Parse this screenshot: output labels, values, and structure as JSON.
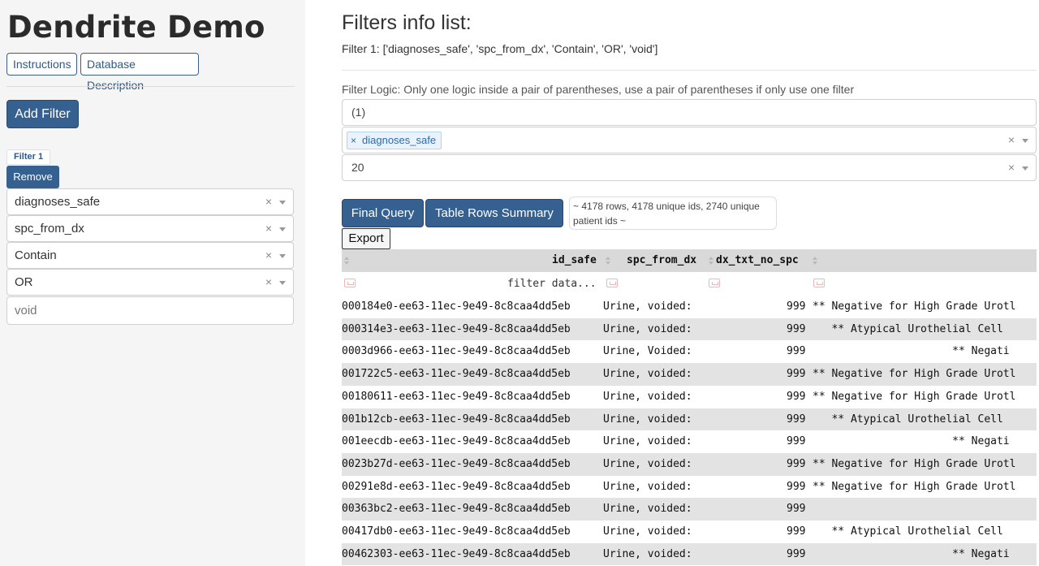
{
  "sidebar": {
    "title": "Dendrite Demo",
    "instructions_label": "Instructions",
    "db_description_label": "Database Description",
    "add_filter_label": "Add Filter",
    "filter_tag": "Filter 1",
    "remove_label": "Remove",
    "fields": [
      "diagnoses_safe",
      "spc_from_dx",
      "Contain",
      "OR"
    ],
    "text_value": "void"
  },
  "main": {
    "title": "Filters info list:",
    "filter_line": "Filter 1: ['diagnoses_safe', 'spc_from_dx', 'Contain', 'OR', 'void']",
    "logic_label": "Filter Logic: Only one logic inside a pair of parentheses, use a pair of parentheses if only use one filter",
    "logic_value": "(1)",
    "selected_chip": "diagnoses_safe",
    "limit_value": "20",
    "final_query_label": "Final Query",
    "table_summary_label": "Table Rows Summary",
    "summary_text": "~ 4178 rows, 4178 unique ids, 2740 unique patient ids ~",
    "export_label": "Export"
  },
  "table": {
    "headers": [
      "id_safe",
      "spc_from_dx",
      "dx_txt_no_spc"
    ],
    "filter_placeholder": "filter data...",
    "rows": [
      [
        "000184e0-ee63-11ec-9e49-8c8caa4dd5eb",
        "Urine, voided:",
        "999",
        "** Negative for High Grade Urotl"
      ],
      [
        "000314e3-ee63-11ec-9e49-8c8caa4dd5eb",
        "Urine, voided:",
        "999",
        "   ** Atypical Urothelial Cell"
      ],
      [
        "0003d966-ee63-11ec-9e49-8c8caa4dd5eb",
        "Urine, Voided:",
        "999",
        "                      ** Negati"
      ],
      [
        "001722c5-ee63-11ec-9e49-8c8caa4dd5eb",
        "Urine, voided:",
        "999",
        "** Negative for High Grade Urotl"
      ],
      [
        "00180611-ee63-11ec-9e49-8c8caa4dd5eb",
        "Urine, voided:",
        "999",
        "** Negative for High Grade Urotl"
      ],
      [
        "001b12cb-ee63-11ec-9e49-8c8caa4dd5eb",
        "Urine, voided:",
        "999",
        "   ** Atypical Urothelial Cell"
      ],
      [
        "001eecdb-ee63-11ec-9e49-8c8caa4dd5eb",
        "Urine, voided:",
        "999",
        "                      ** Negati"
      ],
      [
        "0023b27d-ee63-11ec-9e49-8c8caa4dd5eb",
        "Urine, voided:",
        "999",
        "** Negative for High Grade Urotl"
      ],
      [
        "00291e8d-ee63-11ec-9e49-8c8caa4dd5eb",
        "Urine, voided:",
        "999",
        "** Negative for High Grade Urotl"
      ],
      [
        "00363bc2-ee63-11ec-9e49-8c8caa4dd5eb",
        "Urine, voided:",
        "999",
        ""
      ],
      [
        "00417db0-ee63-11ec-9e49-8c8caa4dd5eb",
        "Urine, voided:",
        "999",
        "   ** Atypical Urothelial Cell"
      ],
      [
        "00462303-ee63-11ec-9e49-8c8caa4dd5eb",
        "Urine, voided:",
        "999",
        "                      ** Negati"
      ]
    ]
  }
}
